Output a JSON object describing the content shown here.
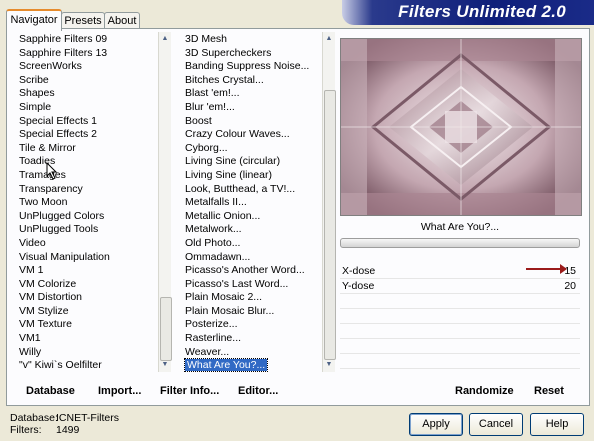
{
  "app": {
    "title": "Filters Unlimited 2.0"
  },
  "tabs": [
    {
      "label": "Navigator",
      "active": true
    },
    {
      "label": "Presets",
      "active": false
    },
    {
      "label": "About",
      "active": false
    }
  ],
  "categories": {
    "items": [
      "Sapphire Filters 09",
      "Sapphire Filters 13",
      "ScreenWorks",
      "Scribe",
      "Shapes",
      "Simple",
      "Special Effects 1",
      "Special Effects 2",
      "Tile & Mirror",
      "Toadies",
      "Tramages",
      "Transparency",
      "Two Moon",
      "UnPlugged Colors",
      "UnPlugged Tools",
      "Video",
      "Visual Manipulation",
      "VM 1",
      "VM Colorize",
      "VM Distortion",
      "VM Stylize",
      "VM Texture",
      "VM1",
      "Willy",
      "\"v\" Kiwi`s Oelfilter"
    ]
  },
  "filters": {
    "items": [
      "3D Mesh",
      "3D Supercheckers",
      "Banding Suppress Noise...",
      "Bitches Crystal...",
      "Blast 'em!...",
      "Blur 'em!...",
      "Boost",
      "Crazy Colour Waves...",
      "Cyborg...",
      "Living Sine (circular)",
      "Living Sine (linear)",
      "Look, Butthead, a TV!...",
      "Metalfalls II...",
      "Metallic Onion...",
      "Metalwork...",
      "Old Photo...",
      "Ommadawn...",
      "Picasso's Another Word...",
      "Picasso's Last Word...",
      "Plain Mosaic 2...",
      "Plain Mosaic Blur...",
      "Posterize...",
      "Rasterline...",
      "Weaver...",
      "What Are You?..."
    ],
    "selected": "What Are You?..."
  },
  "preview": {
    "filter_name": "What Are You?..."
  },
  "params": [
    {
      "label": "X-dose",
      "value": "15"
    },
    {
      "label": "Y-dose",
      "value": "20"
    }
  ],
  "panel_buttons": {
    "database": "Database",
    "import": "Import...",
    "filter_info": "Filter Info...",
    "editor": "Editor...",
    "randomize": "Randomize",
    "reset": "Reset"
  },
  "status": {
    "database_label": "Database:",
    "database_value": "ICNET-Filters",
    "filters_label": "Filters:",
    "filters_value": "1499"
  },
  "dialog_buttons": {
    "apply": "Apply",
    "cancel": "Cancel",
    "help": "Help"
  },
  "colors": {
    "selection": "#316ac5",
    "arrow": "#9b1b1b",
    "banner": "#0f1f7a"
  }
}
